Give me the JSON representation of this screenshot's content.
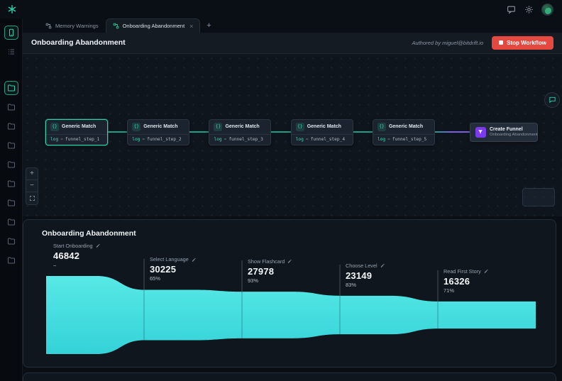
{
  "tabs": {
    "items": [
      {
        "label": "Memory Warnings",
        "active": false,
        "closable": false
      },
      {
        "label": "Onboarding Abandonment",
        "active": true,
        "closable": true
      }
    ],
    "new_tab_label": "+"
  },
  "header": {
    "title": "Onboarding Abandonment",
    "authored_by": "Authored by miguel@bitdrift.io",
    "stop_button_label": "Stop Workflow"
  },
  "sidebar": {
    "top_items": [
      {
        "icon": "device",
        "active": true
      },
      {
        "icon": "list",
        "active": false
      }
    ],
    "folders": [
      {
        "icon": "folder",
        "active": true
      },
      {
        "icon": "folder",
        "active": false
      },
      {
        "icon": "folder",
        "active": false
      },
      {
        "icon": "folder",
        "active": false
      },
      {
        "icon": "folder",
        "active": false
      },
      {
        "icon": "folder",
        "active": false
      },
      {
        "icon": "folder",
        "active": false
      },
      {
        "icon": "folder",
        "active": false
      },
      {
        "icon": "folder",
        "active": false
      },
      {
        "icon": "folder",
        "active": false
      }
    ]
  },
  "topbar_icons": [
    "spark-logo",
    "chat-bubble",
    "gear",
    "user-avatar"
  ],
  "canvas": {
    "nodes": [
      {
        "title": "Generic Match",
        "field": "log",
        "operator": "=",
        "value": "funnel_step_1",
        "selected": true
      },
      {
        "title": "Generic Match",
        "field": "log",
        "operator": "=",
        "value": "funnel_step_2",
        "selected": false
      },
      {
        "title": "Generic Match",
        "field": "log",
        "operator": "=",
        "value": "funnel_step_3",
        "selected": false
      },
      {
        "title": "Generic Match",
        "field": "log",
        "operator": "=",
        "value": "funnel_step_4",
        "selected": false
      },
      {
        "title": "Generic Match",
        "field": "log",
        "operator": "=",
        "value": "funnel_step_5",
        "selected": false
      }
    ],
    "output_node": {
      "title": "Create Funnel",
      "subtitle": "Onboarding Abandonment"
    },
    "controls": {
      "zoom_in": "+",
      "zoom_out": "−",
      "fit": "fit-view"
    }
  },
  "funnel_panel": {
    "title": "Onboarding Abandonment"
  },
  "chart_data": {
    "type": "funnel",
    "title": "Onboarding Abandonment",
    "stages": [
      {
        "label": "Start Onboarding",
        "value": 46842,
        "conversion": "–"
      },
      {
        "label": "Select Language",
        "value": 30225,
        "conversion": "65%"
      },
      {
        "label": "Show Flashcard",
        "value": 27978,
        "conversion": "93%"
      },
      {
        "label": "Choose Level",
        "value": 23149,
        "conversion": "83%"
      },
      {
        "label": "Read First Story",
        "value": 16326,
        "conversion": "71%"
      }
    ],
    "layout": {
      "equal_stage_widths": true,
      "centered_area": true,
      "legend": "none"
    },
    "colors": {
      "area_top": "#57e9e5",
      "area_bottom": "#34d2d8"
    }
  },
  "colors": {
    "teal": "#2fd0aa",
    "red": "#e5483f",
    "purple": "#7b5ee0",
    "cyan": "#4de2e0"
  }
}
